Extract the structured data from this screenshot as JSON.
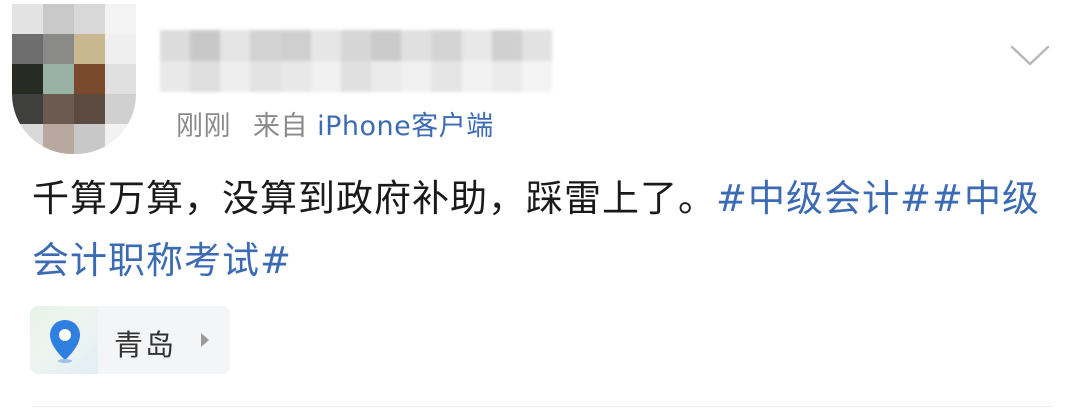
{
  "post": {
    "meta": {
      "time": "刚刚",
      "source_prefix": "来自",
      "source_client": "iPhone客户端"
    },
    "content": {
      "text": "千算万算，没算到政府补助，踩雷上了。",
      "topics": [
        "#中级会计#",
        "#中级会计职称考试#"
      ]
    },
    "location": {
      "name": "青岛",
      "icon": "location-pin-icon"
    },
    "actions": {
      "more_icon": "chevron-down-icon"
    },
    "colors": {
      "link": "#3d6bb3",
      "meta_text": "#8a8a8a",
      "body_text": "#1a1a1a"
    }
  }
}
